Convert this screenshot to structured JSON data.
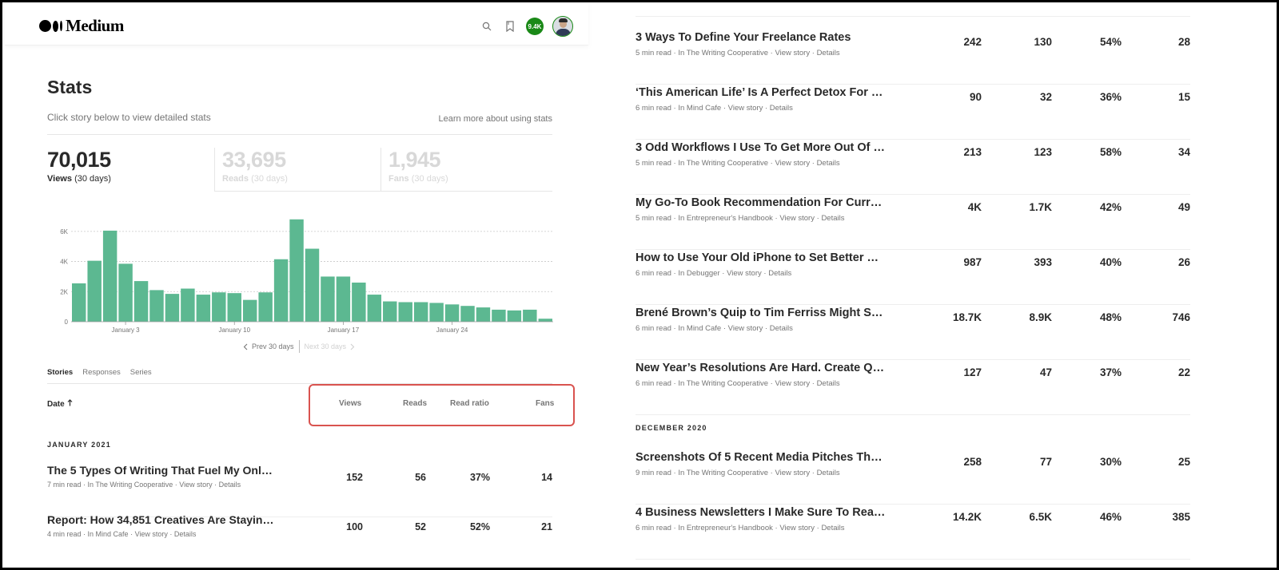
{
  "header": {
    "brand": "Medium",
    "notification_count": "9.4K",
    "icons": [
      "search-icon",
      "bookmark-icon"
    ]
  },
  "page": {
    "title": "Stats",
    "subtitle": "Click story below to view detailed stats",
    "learn_more": "Learn more about using stats"
  },
  "metrics": [
    {
      "value": "70,015",
      "label": "Views",
      "period": "(30 days)",
      "active": true
    },
    {
      "value": "33,695",
      "label": "Reads",
      "period": "(30 days)",
      "active": false
    },
    {
      "value": "1,945",
      "label": "Fans",
      "period": "(30 days)",
      "active": false
    }
  ],
  "chart_data": {
    "type": "bar",
    "categories": [
      "Dec 31",
      "Jan 1",
      "Jan 2",
      "Jan 3",
      "Jan 4",
      "Jan 5",
      "Jan 6",
      "Jan 7",
      "Jan 8",
      "Jan 9",
      "Jan 10",
      "Jan 11",
      "Jan 12",
      "Jan 13",
      "Jan 14",
      "Jan 15",
      "Jan 16",
      "Jan 17",
      "Jan 18",
      "Jan 19",
      "Jan 20",
      "Jan 21",
      "Jan 22",
      "Jan 23",
      "Jan 24",
      "Jan 25",
      "Jan 26",
      "Jan 27",
      "Jan 28",
      "Jan 29",
      "Jan 30"
    ],
    "values": [
      2550,
      4050,
      6050,
      3850,
      2700,
      2100,
      1850,
      2200,
      1800,
      1950,
      1900,
      1450,
      1950,
      4150,
      6800,
      4850,
      3000,
      3000,
      2600,
      1800,
      1350,
      1300,
      1300,
      1250,
      1150,
      1050,
      950,
      800,
      750,
      800,
      200
    ],
    "x_tick_labels": [
      "January 3",
      "January 10",
      "January 17",
      "January 24"
    ],
    "x_tick_indices": [
      3,
      10,
      17,
      24
    ],
    "y_tick_labels": [
      "0",
      "2K",
      "4K",
      "6K"
    ],
    "y_ticks": [
      0,
      2000,
      4000,
      6000
    ],
    "ylim": [
      0,
      7000
    ],
    "grid": true,
    "title": "",
    "xlabel": "",
    "ylabel": "",
    "bar_color": "#5cb891"
  },
  "chart_nav": {
    "prev": "Prev 30 days",
    "next": "Next 30 days"
  },
  "tabs": [
    "Stories",
    "Responses",
    "Series"
  ],
  "table": {
    "sort_label": "Date",
    "columns": [
      "Views",
      "Reads",
      "Read ratio",
      "Fans"
    ]
  },
  "sections": {
    "left_month": "JANUARY 2021",
    "right_month": "DECEMBER 2020"
  },
  "view_story": "View story",
  "details": "Details",
  "left_stories": [
    {
      "title": "The 5 Types Of Writing That Fuel My Online …",
      "read": "7 min read",
      "pub": "In The Writing Cooperative",
      "views": "152",
      "reads": "56",
      "ratio": "37%",
      "fans": "14"
    },
    {
      "title": "Report: How 34,851 Creatives Are Staying In…",
      "read": "4 min read",
      "pub": "In Mind Cafe",
      "views": "100",
      "reads": "52",
      "ratio": "52%",
      "fans": "21"
    }
  ],
  "right_stories": [
    {
      "title": "3 Ways To Define Your Freelance Rates",
      "read": "5 min read",
      "pub": "In The Writing Cooperative",
      "views": "242",
      "reads": "130",
      "ratio": "54%",
      "fans": "28"
    },
    {
      "title": "‘This American Life’ Is A Perfect Detox For P…",
      "read": "6 min read",
      "pub": "In Mind Cafe",
      "views": "90",
      "reads": "32",
      "ratio": "36%",
      "fans": "15"
    },
    {
      "title": "3 Odd Workflows I Use To Get More Out Of …",
      "read": "5 min read",
      "pub": "In The Writing Cooperative",
      "views": "213",
      "reads": "123",
      "ratio": "58%",
      "fans": "34"
    },
    {
      "title": "My Go-To Book Recommendation For Curre…",
      "read": "5 min read",
      "pub": "In Entrepreneur's Handbook",
      "views": "4K",
      "reads": "1.7K",
      "ratio": "42%",
      "fans": "49"
    },
    {
      "title": "How to Use Your Old iPhone to Set Better W…",
      "read": "6 min read",
      "pub": "In Debugger",
      "views": "987",
      "reads": "393",
      "ratio": "40%",
      "fans": "26"
    },
    {
      "title": "Brené Brown’s Quip to Tim Ferriss Might Shi…",
      "read": "6 min read",
      "pub": "In Mind Cafe",
      "views": "18.7K",
      "reads": "8.9K",
      "ratio": "48%",
      "fans": "746"
    },
    {
      "title": "New Year’s Resolutions Are Hard. Create Qu…",
      "read": "6 min read",
      "pub": "In The Writing Cooperative",
      "views": "127",
      "reads": "47",
      "ratio": "37%",
      "fans": "22"
    }
  ],
  "december_stories": [
    {
      "title": "Screenshots Of 5 Recent Media Pitches That…",
      "read": "9 min read",
      "pub": "In The Writing Cooperative",
      "views": "258",
      "reads": "77",
      "ratio": "30%",
      "fans": "25"
    },
    {
      "title": "4 Business Newsletters I Make Sure To Read …",
      "read": "6 min read",
      "pub": "In Entrepreneur's Handbook",
      "views": "14.2K",
      "reads": "6.5K",
      "ratio": "46%",
      "fans": "385"
    }
  ],
  "colors": {
    "accent_green": "#1a8917",
    "highlight_red": "#d9534f"
  }
}
